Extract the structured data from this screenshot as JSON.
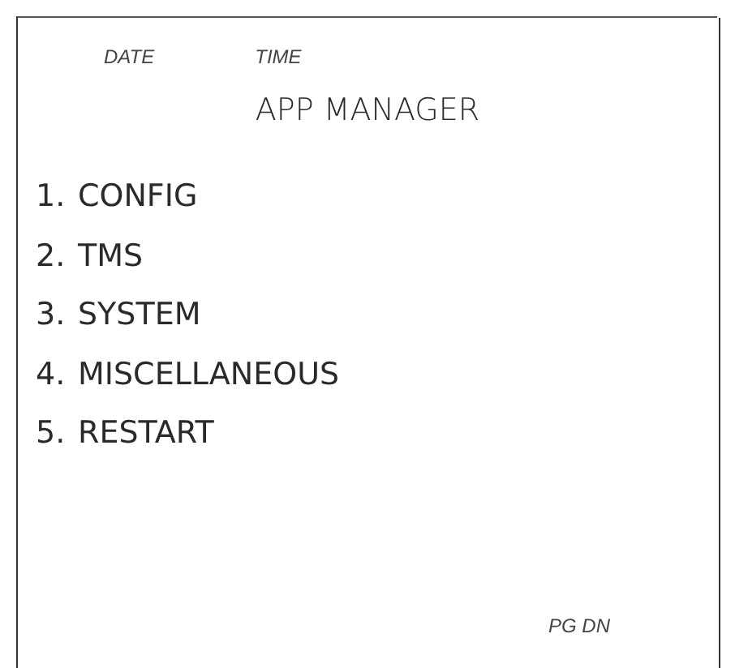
{
  "header": {
    "date": "DATE",
    "time": "TIME"
  },
  "title": "APP MANAGER",
  "menu": [
    {
      "number": "1.",
      "label": "CONFIG"
    },
    {
      "number": "2.",
      "label": "TMS"
    },
    {
      "number": "3.",
      "label": "SYSTEM"
    },
    {
      "number": "4.",
      "label": "MISCELLANEOUS"
    },
    {
      "number": "5.",
      "label": "RESTART"
    }
  ],
  "footer": {
    "page_down": "PG DN"
  }
}
